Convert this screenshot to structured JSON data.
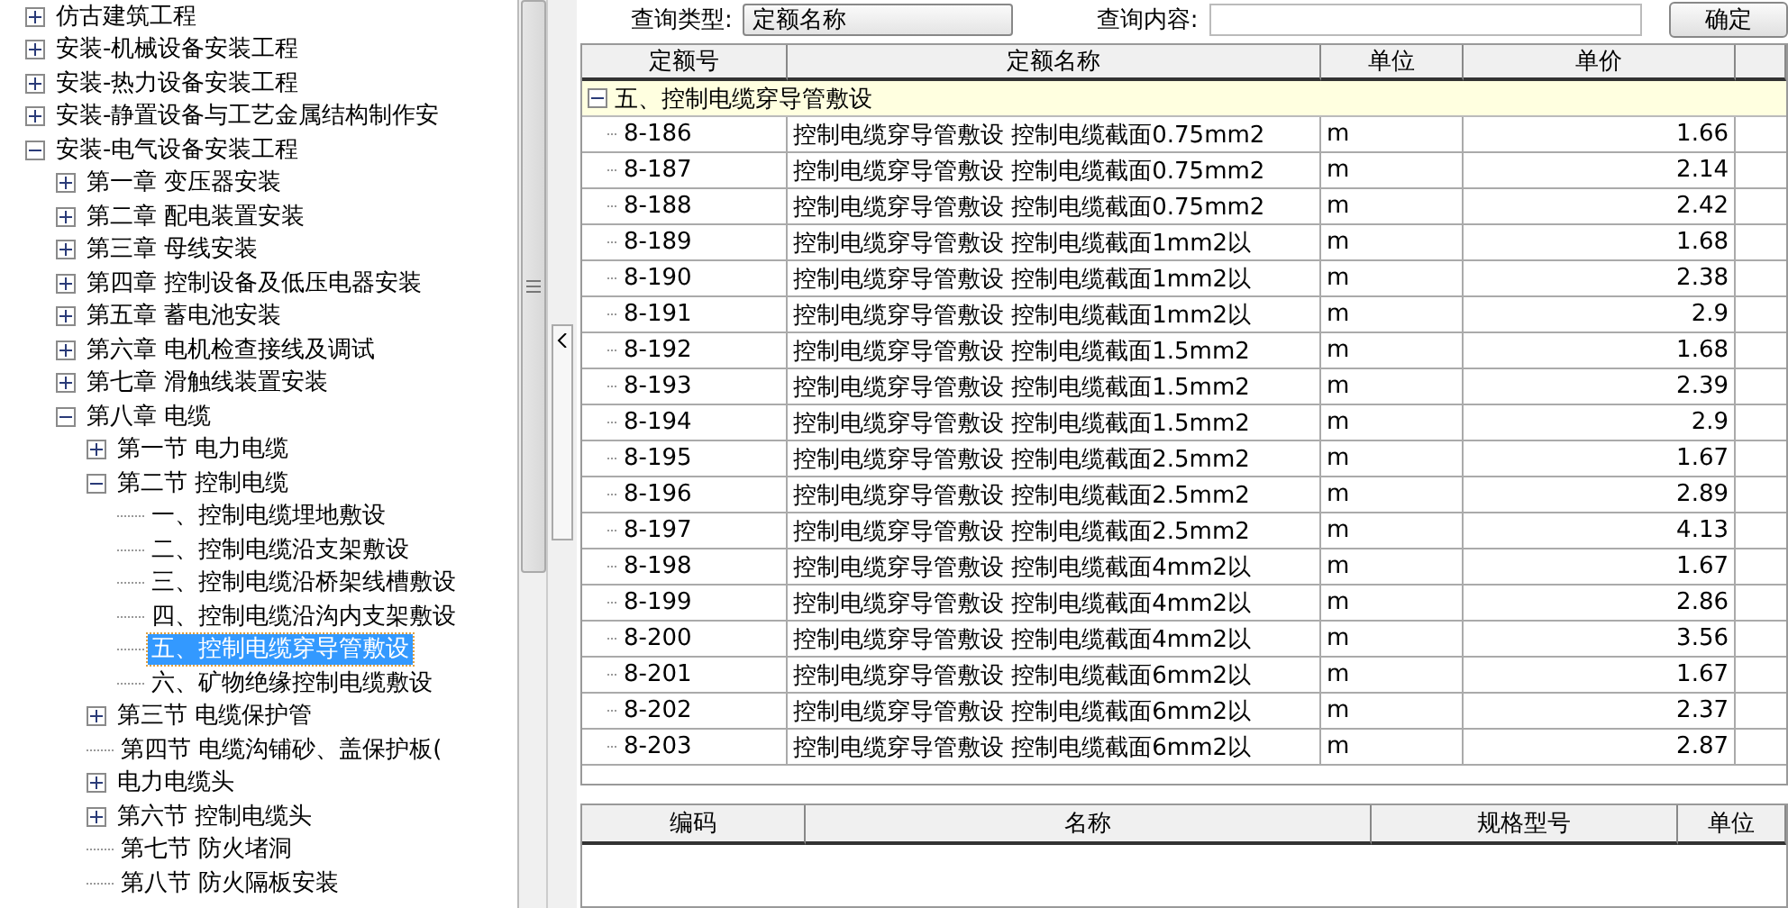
{
  "tree": [
    {
      "label": "仿古建筑工程",
      "kind": "group",
      "expanded": false,
      "selected": false
    },
    {
      "label": "安装-机械设备安装工程",
      "kind": "group",
      "expanded": false,
      "selected": false
    },
    {
      "label": "安装-热力设备安装工程",
      "kind": "group",
      "expanded": false,
      "selected": false
    },
    {
      "label": "安装-静置设备与工艺金属结构制作安",
      "kind": "group",
      "expanded": false,
      "selected": false
    },
    {
      "label": "安装-电气设备安装工程",
      "kind": "group",
      "expanded": true,
      "selected": false,
      "children": [
        {
          "label": "第一章  变压器安装",
          "kind": "group",
          "expanded": false,
          "selected": false
        },
        {
          "label": "第二章  配电装置安装",
          "kind": "group",
          "expanded": false,
          "selected": false
        },
        {
          "label": "第三章  母线安装",
          "kind": "group",
          "expanded": false,
          "selected": false
        },
        {
          "label": "第四章  控制设备及低压电器安装",
          "kind": "group",
          "expanded": false,
          "selected": false
        },
        {
          "label": "第五章  蓄电池安装",
          "kind": "group",
          "expanded": false,
          "selected": false
        },
        {
          "label": "第六章  电机检查接线及调试",
          "kind": "group",
          "expanded": false,
          "selected": false
        },
        {
          "label": "第七章  滑触线装置安装",
          "kind": "group",
          "expanded": false,
          "selected": false
        },
        {
          "label": "第八章  电缆",
          "kind": "group",
          "expanded": true,
          "selected": false,
          "children": [
            {
              "label": "第一节  电力电缆",
              "kind": "group",
              "expanded": false,
              "selected": false
            },
            {
              "label": "第二节  控制电缆",
              "kind": "group",
              "expanded": true,
              "selected": false,
              "children": [
                {
                  "label": "一、控制电缆埋地敷设",
                  "kind": "leaf",
                  "selected": false
                },
                {
                  "label": "二、控制电缆沿支架敷设",
                  "kind": "leaf",
                  "selected": false
                },
                {
                  "label": "三、控制电缆沿桥架线槽敷设",
                  "kind": "leaf",
                  "selected": false
                },
                {
                  "label": "四、控制电缆沿沟内支架敷设",
                  "kind": "leaf",
                  "selected": false
                },
                {
                  "label": "五、控制电缆穿导管敷设",
                  "kind": "leaf",
                  "selected": true
                },
                {
                  "label": "六、矿物绝缘控制电缆敷设",
                  "kind": "leaf",
                  "selected": false
                }
              ]
            },
            {
              "label": "第三节  电缆保护管",
              "kind": "group",
              "expanded": false,
              "selected": false
            },
            {
              "label": "第四节  电缆沟铺砂、盖保护板(",
              "kind": "leaf",
              "selected": false
            },
            {
              "label": "电力电缆头",
              "kind": "group",
              "expanded": false,
              "selected": false
            },
            {
              "label": "第六节  控制电缆头",
              "kind": "group",
              "expanded": false,
              "selected": false
            },
            {
              "label": "第七节  防火堵洞",
              "kind": "leaf",
              "selected": false
            },
            {
              "label": "第八节  防火隔板安装",
              "kind": "leaf",
              "selected": false
            }
          ]
        }
      ]
    }
  ],
  "query": {
    "type_label": "查询类型:",
    "type_value": "定额名称",
    "content_label": "查询内容:",
    "button": "确定"
  },
  "quota_table": {
    "columns": [
      "定额号",
      "定额名称",
      "单位",
      "单价"
    ],
    "group": {
      "label": "五、控制电缆穿导管敷设",
      "expanded": true
    },
    "rows": [
      [
        "8-186",
        "控制电缆穿导管敷设  控制电缆截面0.75mm2",
        "m",
        "1.66"
      ],
      [
        "8-187",
        "控制电缆穿导管敷设  控制电缆截面0.75mm2",
        "m",
        "2.14"
      ],
      [
        "8-188",
        "控制电缆穿导管敷设  控制电缆截面0.75mm2",
        "m",
        "2.42"
      ],
      [
        "8-189",
        "控制电缆穿导管敷设  控制电缆截面1mm2以",
        "m",
        "1.68"
      ],
      [
        "8-190",
        "控制电缆穿导管敷设  控制电缆截面1mm2以",
        "m",
        "2.38"
      ],
      [
        "8-191",
        "控制电缆穿导管敷设  控制电缆截面1mm2以",
        "m",
        "2.9"
      ],
      [
        "8-192",
        "控制电缆穿导管敷设  控制电缆截面1.5mm2",
        "m",
        "1.68"
      ],
      [
        "8-193",
        "控制电缆穿导管敷设  控制电缆截面1.5mm2",
        "m",
        "2.39"
      ],
      [
        "8-194",
        "控制电缆穿导管敷设  控制电缆截面1.5mm2",
        "m",
        "2.9"
      ],
      [
        "8-195",
        "控制电缆穿导管敷设  控制电缆截面2.5mm2",
        "m",
        "1.67"
      ],
      [
        "8-196",
        "控制电缆穿导管敷设  控制电缆截面2.5mm2",
        "m",
        "2.89"
      ],
      [
        "8-197",
        "控制电缆穿导管敷设  控制电缆截面2.5mm2",
        "m",
        "4.13"
      ],
      [
        "8-198",
        "控制电缆穿导管敷设  控制电缆截面4mm2以",
        "m",
        "1.67"
      ],
      [
        "8-199",
        "控制电缆穿导管敷设  控制电缆截面4mm2以",
        "m",
        "2.86"
      ],
      [
        "8-200",
        "控制电缆穿导管敷设  控制电缆截面4mm2以",
        "m",
        "3.56"
      ],
      [
        "8-201",
        "控制电缆穿导管敷设  控制电缆截面6mm2以",
        "m",
        "1.67"
      ],
      [
        "8-202",
        "控制电缆穿导管敷设  控制电缆截面6mm2以",
        "m",
        "2.37"
      ],
      [
        "8-203",
        "控制电缆穿导管敷设  控制电缆截面6mm2以",
        "m",
        "2.87"
      ]
    ]
  },
  "material_table": {
    "columns": [
      "编码",
      "名称",
      "规格型号",
      "单位"
    ]
  }
}
